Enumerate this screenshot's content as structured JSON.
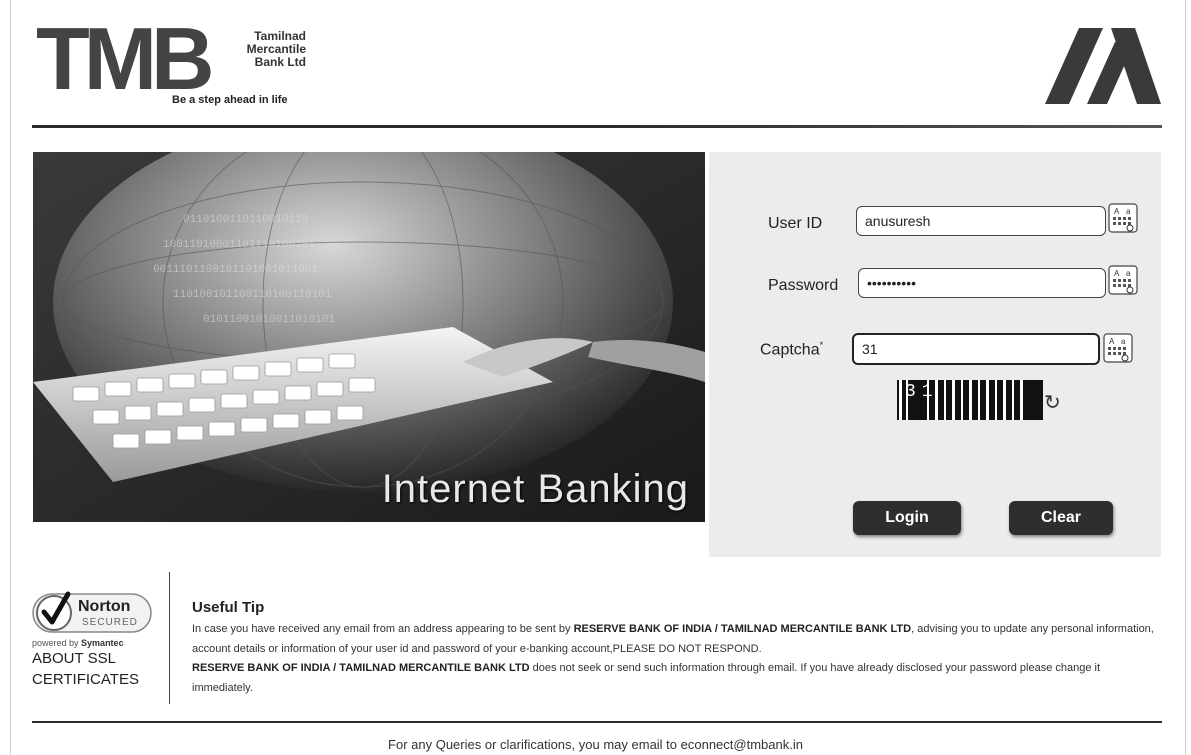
{
  "header": {
    "logo_letters": "TMB",
    "bank_name_lines": [
      "Tamilnad",
      "Mercantile",
      "Bank Ltd"
    ],
    "tagline": "Be a step ahead in life"
  },
  "hero": {
    "caption": "Internet Banking"
  },
  "login": {
    "userid_label": "User ID",
    "userid_value": "anusuresh",
    "password_label": "Password",
    "password_value": "••••••••••",
    "captcha_label": "Captcha",
    "captcha_required_mark": "*",
    "captcha_value": "31",
    "captcha_image_text": "31",
    "login_button": "Login",
    "clear_button": "Clear",
    "icons": {
      "virtual_keyboard": "virtual-keyboard-icon",
      "refresh": "refresh-icon"
    }
  },
  "security_badge": {
    "brand": "Norton",
    "secured": "SECURED",
    "powered_prefix": "powered by",
    "powered_by": "Symantec",
    "about_line1": "ABOUT SSL",
    "about_line2": "CERTIFICATES"
  },
  "tip": {
    "title": "Useful Tip",
    "p1_a": "In case you have received any email from an address appearing to be sent by ",
    "p1_b": "RESERVE BANK OF INDIA / TAMILNAD MERCANTILE BANK LTD",
    "p1_c": ", advising you to update any personal information, account details or information of your user id and password of your e-banking account,PLEASE DO NOT RESPOND.",
    "p2_a": "RESERVE BANK OF INDIA / TAMILNAD MERCANTILE BANK LTD",
    "p2_b": " does not seek or send such information through email. If you have already disclosed your password please change it immediately."
  },
  "footer": {
    "text": "For any Queries or clarifications, you may email to ",
    "email": "econnect@tmbank.in"
  },
  "colors": {
    "panel_bg": "#ececec",
    "button_bg": "#2e2e2e",
    "rule": "#2a2a2a"
  }
}
